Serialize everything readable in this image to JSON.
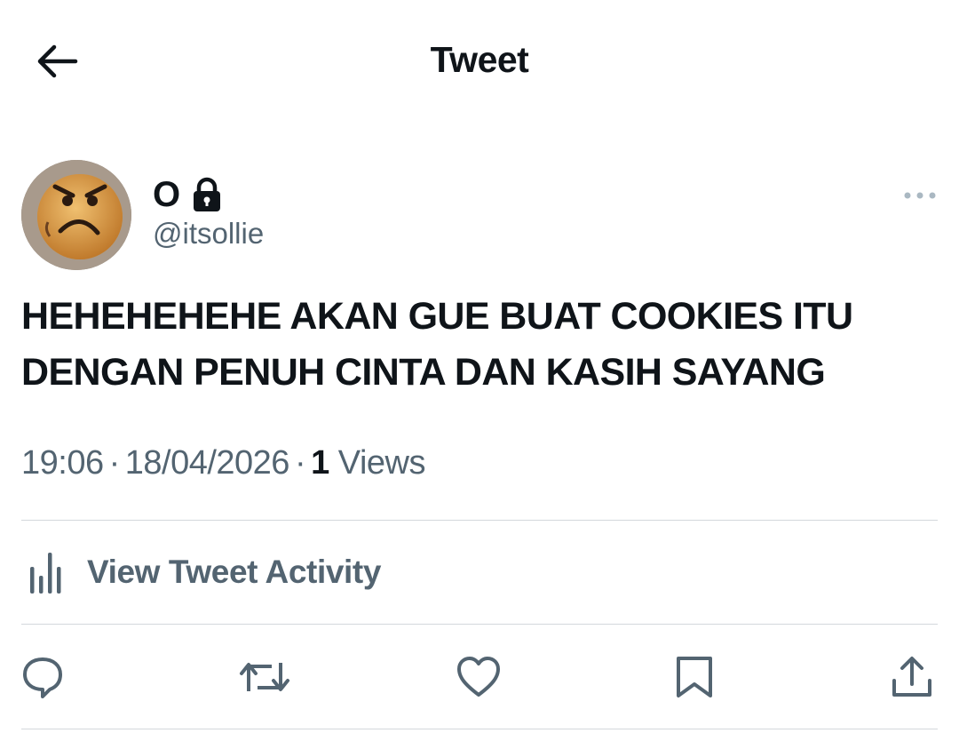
{
  "header": {
    "title": "Tweet",
    "back_icon": "arrow-left-icon"
  },
  "tweet": {
    "author": {
      "display_name": "O",
      "handle": "@itsollie",
      "protected_icon": "lock-icon",
      "avatar": "angry-cookie-avatar"
    },
    "text": "HEHEHEHEHE AKAN GUE BUAT COOKIES ITU DENGAN PENUH CINTA DAN KASIH SAYANG",
    "time": "19:06",
    "separator": "·",
    "date": "18/04/2026",
    "views_count": "1",
    "views_label": "Views",
    "more_icon": "more-horizontal-icon"
  },
  "activity": {
    "label": "View Tweet Activity",
    "icon": "analytics-bars-icon"
  },
  "actions": [
    {
      "name": "reply",
      "icon": "reply-icon"
    },
    {
      "name": "retweet",
      "icon": "retweet-icon"
    },
    {
      "name": "like",
      "icon": "heart-icon"
    },
    {
      "name": "bookmark",
      "icon": "bookmark-icon"
    },
    {
      "name": "share",
      "icon": "share-icon"
    }
  ],
  "colors": {
    "text_primary": "#0f1419",
    "text_secondary": "#536471",
    "divider": "#d3d8dc",
    "background": "#ffffff"
  }
}
